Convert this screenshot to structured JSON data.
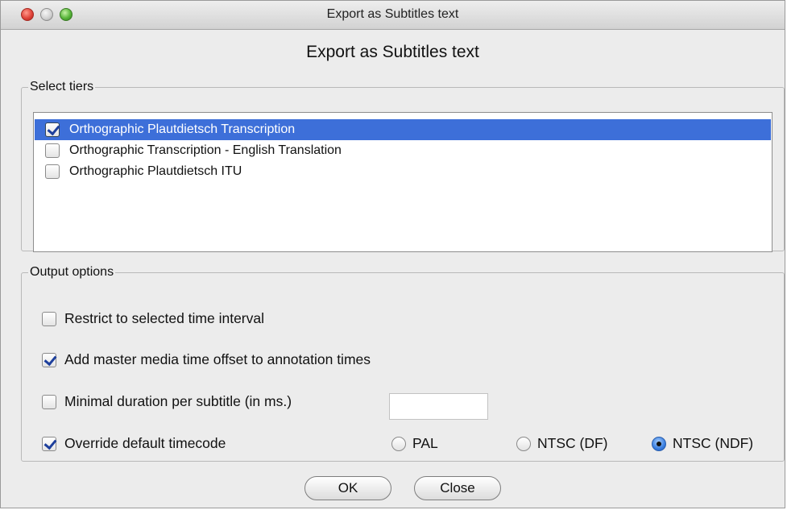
{
  "window": {
    "title": "Export as Subtitles text"
  },
  "dialog": {
    "heading": "Export as Subtitles text"
  },
  "tiers": {
    "legend": "Select tiers",
    "items": [
      {
        "label": "Orthographic Plautdietsch Transcription",
        "checked": true,
        "selected": true
      },
      {
        "label": "Orthographic Transcription - English Translation",
        "checked": false,
        "selected": false
      },
      {
        "label": "Orthographic Plautdietsch ITU",
        "checked": false,
        "selected": false
      }
    ]
  },
  "options": {
    "legend": "Output options",
    "restrict_label": "Restrict to selected time interval",
    "restrict_checked": false,
    "master_offset_label": "Add master media time offset to annotation times",
    "master_offset_checked": true,
    "min_duration_label": "Minimal duration per subtitle (in ms.)",
    "min_duration_checked": false,
    "min_duration_value": "",
    "override_label": "Override default timecode",
    "override_checked": true,
    "timecode_options": [
      "PAL",
      "NTSC (DF)",
      "NTSC (NDF)"
    ],
    "timecode_selected": "NTSC (NDF)"
  },
  "buttons": {
    "ok": "OK",
    "close": "Close"
  }
}
